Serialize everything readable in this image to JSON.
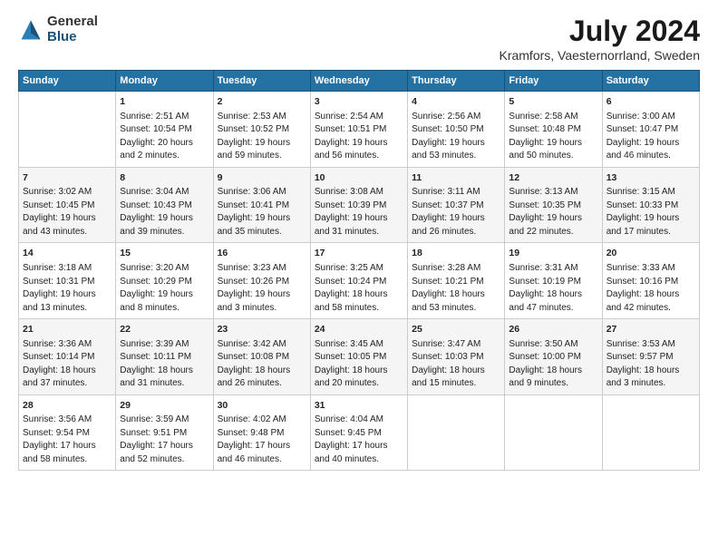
{
  "header": {
    "logo_general": "General",
    "logo_blue": "Blue",
    "title": "July 2024",
    "subtitle": "Kramfors, Vaesternorrland, Sweden"
  },
  "calendar": {
    "days": [
      "Sunday",
      "Monday",
      "Tuesday",
      "Wednesday",
      "Thursday",
      "Friday",
      "Saturday"
    ],
    "weeks": [
      [
        {
          "date": "",
          "content": ""
        },
        {
          "date": "1",
          "content": "Sunrise: 2:51 AM\nSunset: 10:54 PM\nDaylight: 20 hours\nand 2 minutes."
        },
        {
          "date": "2",
          "content": "Sunrise: 2:53 AM\nSunset: 10:52 PM\nDaylight: 19 hours\nand 59 minutes."
        },
        {
          "date": "3",
          "content": "Sunrise: 2:54 AM\nSunset: 10:51 PM\nDaylight: 19 hours\nand 56 minutes."
        },
        {
          "date": "4",
          "content": "Sunrise: 2:56 AM\nSunset: 10:50 PM\nDaylight: 19 hours\nand 53 minutes."
        },
        {
          "date": "5",
          "content": "Sunrise: 2:58 AM\nSunset: 10:48 PM\nDaylight: 19 hours\nand 50 minutes."
        },
        {
          "date": "6",
          "content": "Sunrise: 3:00 AM\nSunset: 10:47 PM\nDaylight: 19 hours\nand 46 minutes."
        }
      ],
      [
        {
          "date": "7",
          "content": "Sunrise: 3:02 AM\nSunset: 10:45 PM\nDaylight: 19 hours\nand 43 minutes."
        },
        {
          "date": "8",
          "content": "Sunrise: 3:04 AM\nSunset: 10:43 PM\nDaylight: 19 hours\nand 39 minutes."
        },
        {
          "date": "9",
          "content": "Sunrise: 3:06 AM\nSunset: 10:41 PM\nDaylight: 19 hours\nand 35 minutes."
        },
        {
          "date": "10",
          "content": "Sunrise: 3:08 AM\nSunset: 10:39 PM\nDaylight: 19 hours\nand 31 minutes."
        },
        {
          "date": "11",
          "content": "Sunrise: 3:11 AM\nSunset: 10:37 PM\nDaylight: 19 hours\nand 26 minutes."
        },
        {
          "date": "12",
          "content": "Sunrise: 3:13 AM\nSunset: 10:35 PM\nDaylight: 19 hours\nand 22 minutes."
        },
        {
          "date": "13",
          "content": "Sunrise: 3:15 AM\nSunset: 10:33 PM\nDaylight: 19 hours\nand 17 minutes."
        }
      ],
      [
        {
          "date": "14",
          "content": "Sunrise: 3:18 AM\nSunset: 10:31 PM\nDaylight: 19 hours\nand 13 minutes."
        },
        {
          "date": "15",
          "content": "Sunrise: 3:20 AM\nSunset: 10:29 PM\nDaylight: 19 hours\nand 8 minutes."
        },
        {
          "date": "16",
          "content": "Sunrise: 3:23 AM\nSunset: 10:26 PM\nDaylight: 19 hours\nand 3 minutes."
        },
        {
          "date": "17",
          "content": "Sunrise: 3:25 AM\nSunset: 10:24 PM\nDaylight: 18 hours\nand 58 minutes."
        },
        {
          "date": "18",
          "content": "Sunrise: 3:28 AM\nSunset: 10:21 PM\nDaylight: 18 hours\nand 53 minutes."
        },
        {
          "date": "19",
          "content": "Sunrise: 3:31 AM\nSunset: 10:19 PM\nDaylight: 18 hours\nand 47 minutes."
        },
        {
          "date": "20",
          "content": "Sunrise: 3:33 AM\nSunset: 10:16 PM\nDaylight: 18 hours\nand 42 minutes."
        }
      ],
      [
        {
          "date": "21",
          "content": "Sunrise: 3:36 AM\nSunset: 10:14 PM\nDaylight: 18 hours\nand 37 minutes."
        },
        {
          "date": "22",
          "content": "Sunrise: 3:39 AM\nSunset: 10:11 PM\nDaylight: 18 hours\nand 31 minutes."
        },
        {
          "date": "23",
          "content": "Sunrise: 3:42 AM\nSunset: 10:08 PM\nDaylight: 18 hours\nand 26 minutes."
        },
        {
          "date": "24",
          "content": "Sunrise: 3:45 AM\nSunset: 10:05 PM\nDaylight: 18 hours\nand 20 minutes."
        },
        {
          "date": "25",
          "content": "Sunrise: 3:47 AM\nSunset: 10:03 PM\nDaylight: 18 hours\nand 15 minutes."
        },
        {
          "date": "26",
          "content": "Sunrise: 3:50 AM\nSunset: 10:00 PM\nDaylight: 18 hours\nand 9 minutes."
        },
        {
          "date": "27",
          "content": "Sunrise: 3:53 AM\nSunset: 9:57 PM\nDaylight: 18 hours\nand 3 minutes."
        }
      ],
      [
        {
          "date": "28",
          "content": "Sunrise: 3:56 AM\nSunset: 9:54 PM\nDaylight: 17 hours\nand 58 minutes."
        },
        {
          "date": "29",
          "content": "Sunrise: 3:59 AM\nSunset: 9:51 PM\nDaylight: 17 hours\nand 52 minutes."
        },
        {
          "date": "30",
          "content": "Sunrise: 4:02 AM\nSunset: 9:48 PM\nDaylight: 17 hours\nand 46 minutes."
        },
        {
          "date": "31",
          "content": "Sunrise: 4:04 AM\nSunset: 9:45 PM\nDaylight: 17 hours\nand 40 minutes."
        },
        {
          "date": "",
          "content": ""
        },
        {
          "date": "",
          "content": ""
        },
        {
          "date": "",
          "content": ""
        }
      ]
    ]
  }
}
